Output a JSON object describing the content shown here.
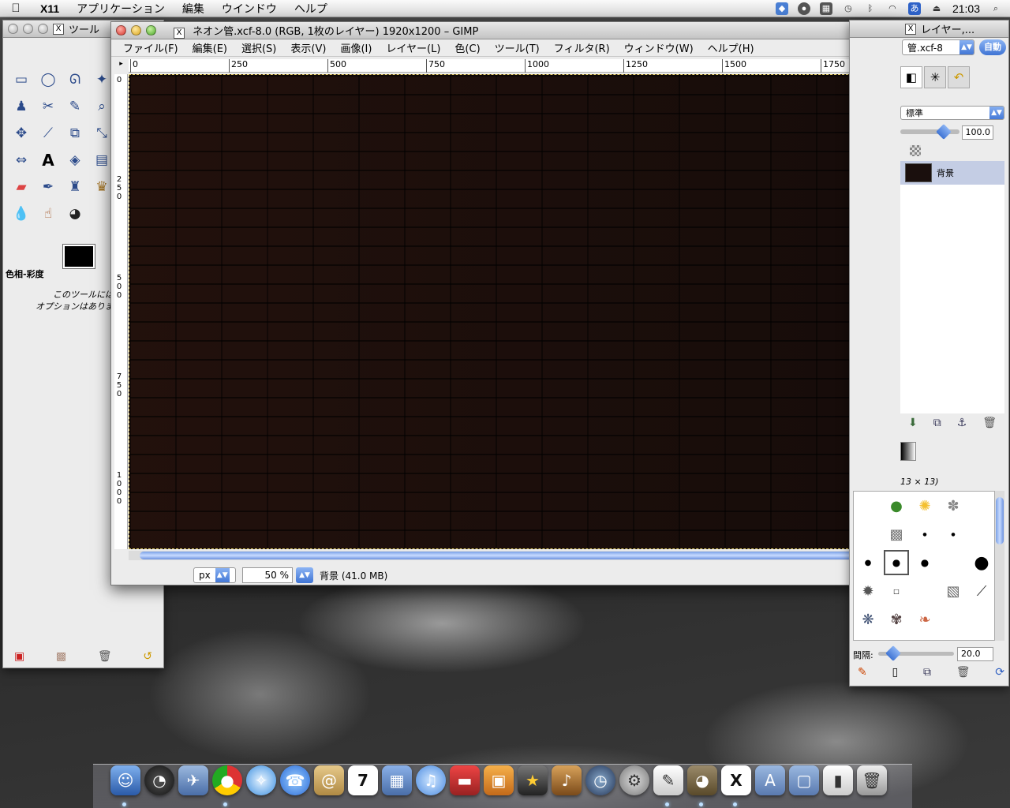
{
  "menubar": {
    "app_name": "X11",
    "items": [
      "アプリケーション",
      "編集",
      "ウインドウ",
      "ヘルプ"
    ],
    "ime": "あ",
    "clock": "21:03"
  },
  "toolbox": {
    "title": "ツール",
    "tool_name": "色相-彩度",
    "message_line1": "このツールには",
    "message_line2": "オプションはありま"
  },
  "image_window": {
    "title": "ネオン管.xcf-8.0 (RGB, 1枚のレイヤー) 1920x1200 – GIMP",
    "menus": [
      "ファイル(F)",
      "編集(E)",
      "選択(S)",
      "表示(V)",
      "画像(I)",
      "レイヤー(L)",
      "色(C)",
      "ツール(T)",
      "フィルタ(R)",
      "ウィンドウ(W)",
      "ヘルプ(H)"
    ],
    "hruler": [
      "0",
      "250",
      "500",
      "750",
      "1000",
      "1250",
      "1500",
      "1750"
    ],
    "vruler": [
      "0",
      "250",
      "500",
      "750",
      "1000"
    ],
    "status": {
      "unit": "px",
      "zoom": "50 %",
      "message": "背景 (41.0 MB)"
    }
  },
  "dock": {
    "title": "レイヤー,...",
    "image_select": "管.xcf-8",
    "auto_button": "自動",
    "mode": "標準",
    "opacity": "100.0",
    "layer_name": "背景",
    "brush_label": "13 × 13)",
    "spacing_label": "間隔:",
    "spacing_value": "20.0"
  },
  "dock_apps": [
    "Finder",
    "Dashboard",
    "Mail",
    "Chrome",
    "Safari",
    "iChat",
    "Address Book",
    "iCal",
    "iPhoto",
    "iTunes",
    "Keynote",
    "Preview",
    "iMovie",
    "GarageBand",
    "Time Machine",
    "System Preferences",
    "TextEdit",
    "GIMP",
    "X11",
    "Applications",
    "Documents",
    "Downloads",
    "Trash"
  ],
  "colors": {
    "canvas": "#1a0f0d",
    "accent": "#3f74d4"
  }
}
